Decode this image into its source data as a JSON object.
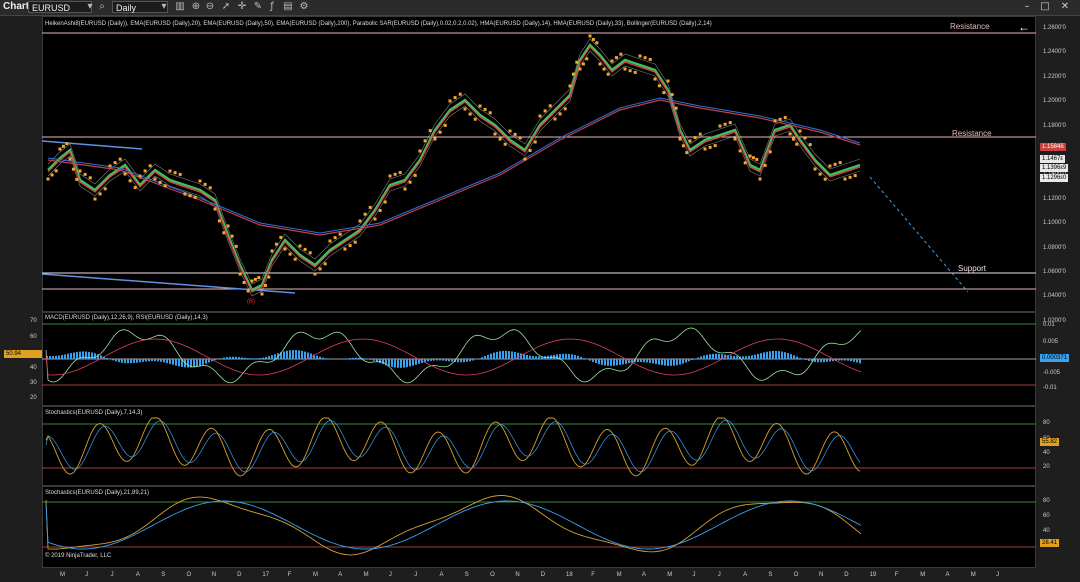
{
  "toolbar": {
    "title": "Chart",
    "instrument": "EURUSD",
    "timeframe": "Daily"
  },
  "panels": {
    "price": {
      "indicators": "HeikenAshi8(EURUSD (Daily)), EMA(EURUSD (Daily),20), EMA(EURUSD (Daily),50), EMA(EURUSD (Daily),200), Parabolic SAR(EURUSD (Daily),0.02,0.2,0.02), HMA(EURUSD (Daily),14), HMA(EURUSD (Daily),33), Bollinger(EURUSD (Daily),2,14)",
      "ticks": [
        "1.2600'0",
        "1.2400'0",
        "1.2200'0",
        "1.2000'0",
        "1.1800'0",
        "1.1600'0",
        "1.1400'0",
        "1.1200'0",
        "1.1000'0",
        "1.0800'0",
        "1.0600'0",
        "1.0400'0",
        "1.0200'0"
      ],
      "flags": [
        {
          "text": "1.1584δ",
          "bg": "#c94040",
          "color": "#ffffff"
        },
        {
          "text": "1.1467ε",
          "bg": "#e8e8e8",
          "color": "#000000"
        },
        {
          "text": "1.1396ε9",
          "bg": "#e8e8e8",
          "color": "#000000"
        },
        {
          "text": "1.1296ε0",
          "bg": "#e8e8e8",
          "color": "#000000"
        }
      ],
      "annotations": {
        "resistance_top": "Resistance",
        "resistance_mid": "Resistance",
        "support": "Support",
        "wave_b": "(B)"
      }
    },
    "macd": {
      "indicators": "MACD(EURUSD (Daily),12,26,9), RSI(EURUSD (Daily),14,3)",
      "left_ticks": [
        "70",
        "60",
        "50",
        "40",
        "30",
        "20"
      ],
      "left_flag": "50.94",
      "right_ticks": [
        "0.01",
        "0.005",
        "0",
        "-0.005",
        "-0.01"
      ],
      "right_flag": "0.000371"
    },
    "stoch1": {
      "indicators": "Stochastics(EURUSD (Daily),7,14,3)",
      "ticks": [
        "80",
        "60",
        "40",
        "20"
      ],
      "flag": "55.82"
    },
    "stoch2": {
      "indicators": "Stochastics(EURUSD (Daily),21,89,21)",
      "ticks": [
        "80",
        "60",
        "40",
        "20"
      ],
      "flag": "28.41",
      "copyright": "© 2019 NinjaTrader, LLC"
    }
  },
  "x_axis": [
    "M",
    "J",
    "J",
    "A",
    "S",
    "O",
    "N",
    "D",
    "17",
    "F",
    "M",
    "A",
    "M",
    "J",
    "J",
    "A",
    "S",
    "O",
    "N",
    "D",
    "18",
    "F",
    "M",
    "A",
    "M",
    "J",
    "J",
    "A",
    "S",
    "O",
    "N",
    "D",
    "19",
    "F",
    "M",
    "A",
    "M",
    "J"
  ],
  "colors": {
    "background": "#000000",
    "resistance": "#e8b8b8",
    "support": "#f0e0e0",
    "sar": "#f0a830",
    "ema200": "#c0404a",
    "macd_hist": "#3aa0f0",
    "stoch_k": "#d8a030",
    "stoch_d": "#3aa0f0"
  }
}
